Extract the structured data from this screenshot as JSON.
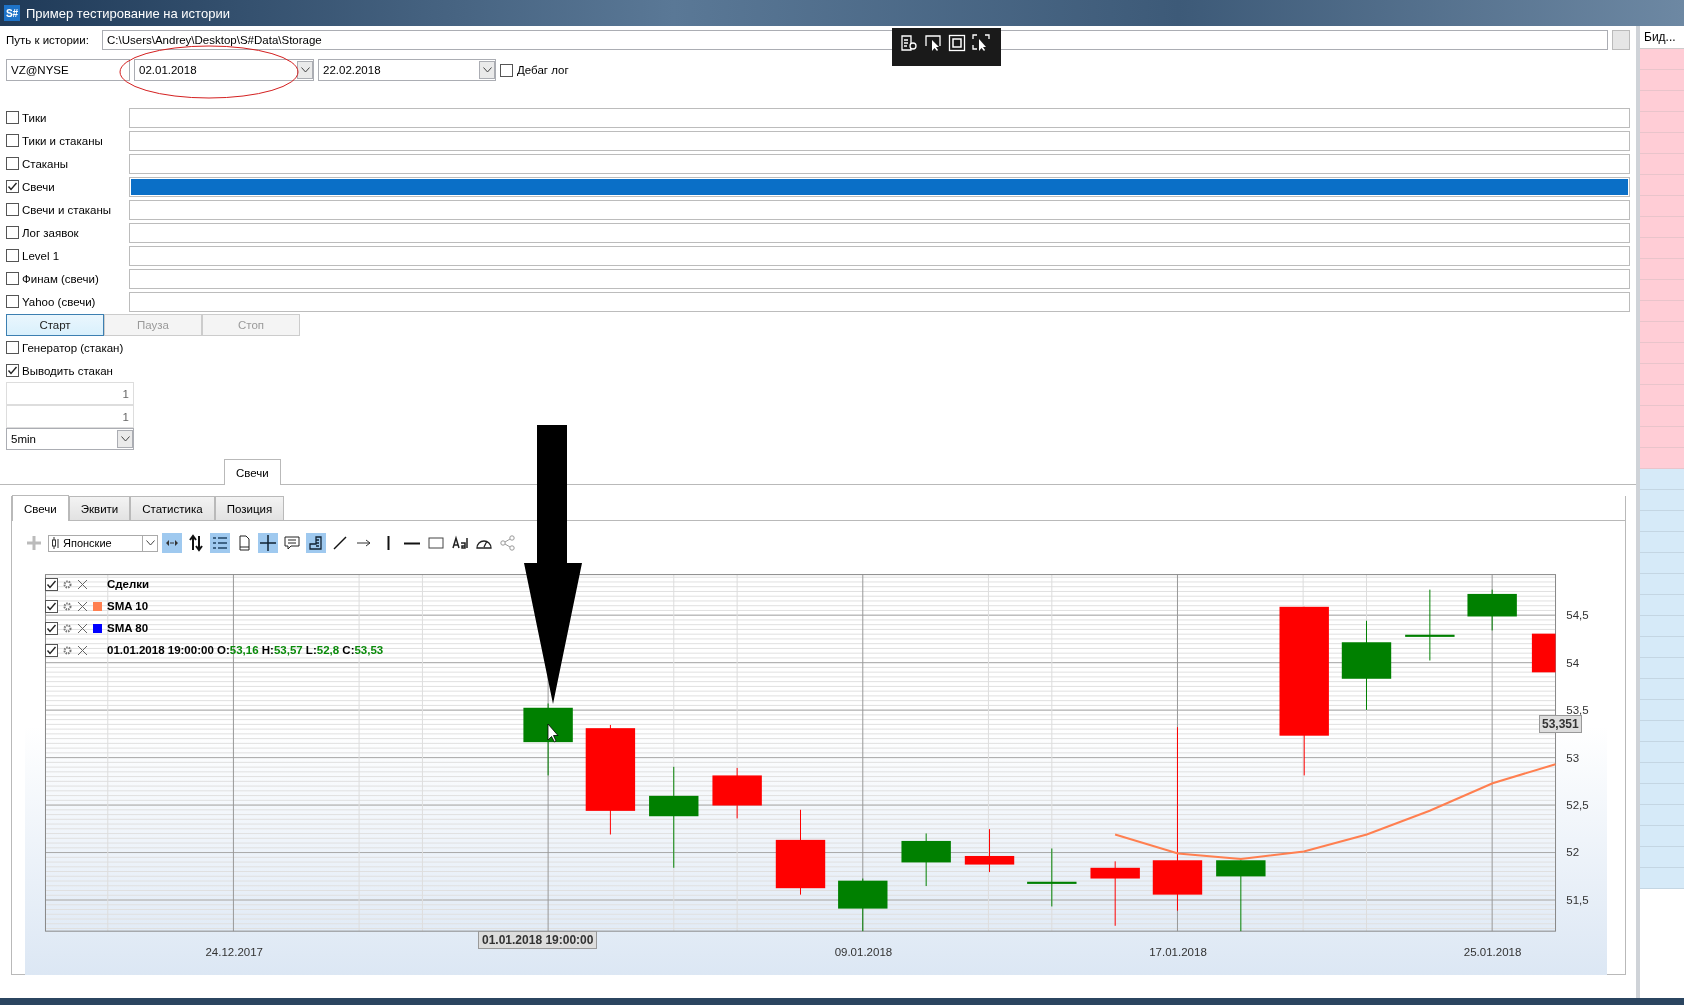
{
  "window": {
    "title": "Пример тестирование на истории",
    "icon_text": "S#"
  },
  "history_path": {
    "label": "Путь к истории:",
    "value": "C:\\Users\\Andrey\\Desktop\\S#Data\\Storage"
  },
  "security": {
    "value": "VZ@NYSE"
  },
  "date_from": {
    "value": "02.01.2018"
  },
  "date_to": {
    "value": "22.02.2018"
  },
  "debug_log": {
    "label": "Дебаг лог",
    "checked": false
  },
  "sources": [
    {
      "label": "Тики",
      "checked": false,
      "selected": false
    },
    {
      "label": "Тики и стаканы",
      "checked": false,
      "selected": false
    },
    {
      "label": "Стаканы",
      "checked": false,
      "selected": false
    },
    {
      "label": "Свечи",
      "checked": true,
      "selected": true
    },
    {
      "label": "Свечи и стаканы",
      "checked": false,
      "selected": false
    },
    {
      "label": "Лог заявок",
      "checked": false,
      "selected": false
    },
    {
      "label": "Level 1",
      "checked": false,
      "selected": false
    },
    {
      "label": "Финам (свечи)",
      "checked": false,
      "selected": false
    },
    {
      "label": "Yahoo (свечи)",
      "checked": false,
      "selected": false
    }
  ],
  "buttons": [
    {
      "label": "Старт",
      "disabled": false,
      "selected": true
    },
    {
      "label": "Пауза",
      "disabled": true,
      "selected": false
    },
    {
      "label": "Стоп",
      "disabled": true,
      "selected": false
    }
  ],
  "options": [
    {
      "label": "Генератор (стакан)",
      "checked": false
    },
    {
      "label": "Выводить стакан",
      "checked": true
    }
  ],
  "numeric_fields": [
    {
      "value": "1"
    },
    {
      "value": "1"
    }
  ],
  "timeframe": {
    "value": "5min"
  },
  "outer_tabs": [
    {
      "label": "Свечи",
      "selected": true
    }
  ],
  "inner_tabs": [
    {
      "label": "Свечи",
      "selected": true
    },
    {
      "label": "Эквити",
      "selected": false
    },
    {
      "label": "Статистика",
      "selected": false
    },
    {
      "label": "Позиция",
      "selected": false
    }
  ],
  "chart_toolbar": {
    "chart_style": "Японские",
    "tools": [
      {
        "kind": "autoscroll",
        "pressed": true
      },
      {
        "kind": "updown",
        "pressed": false
      },
      {
        "kind": "legend",
        "pressed": true
      },
      {
        "kind": "page",
        "pressed": false
      },
      {
        "kind": "crosshair",
        "pressed": true
      },
      {
        "kind": "comment",
        "pressed": false
      },
      {
        "kind": "ruler",
        "pressed": true
      },
      {
        "kind": "line",
        "pressed": false
      },
      {
        "kind": "arrow",
        "pressed": false
      },
      {
        "kind": "vline",
        "pressed": false
      },
      {
        "kind": "hline",
        "pressed": false
      },
      {
        "kind": "rect",
        "pressed": false
      },
      {
        "kind": "text",
        "pressed": false
      },
      {
        "kind": "gauge",
        "pressed": false
      },
      {
        "kind": "share",
        "pressed": false
      }
    ]
  },
  "legend": [
    {
      "label": "Сделки",
      "checked": true
    },
    {
      "kind": "series",
      "checked": true,
      "color": "#ff7f50"
    },
    {
      "label": "SMA 80",
      "checked": true,
      "color": "#0000ff"
    },
    {
      "checked": true,
      "parts": [
        {
          "text": "01.01.2018 19:00:00 O:",
          "kind": "name"
        },
        {
          "text": "53,16",
          "kind": "value"
        },
        {
          "text": " H:",
          "kind": "name"
        },
        {
          "text": "53,57",
          "kind": "value"
        },
        {
          "text": " L:",
          "kind": "name"
        },
        {
          "text": "52,8",
          "kind": "value"
        },
        {
          "text": " C:",
          "kind": "name"
        },
        {
          "text": "53,53",
          "kind": "value"
        }
      ]
    }
  ],
  "chart": {
    "chart_data": {
      "type": "line",
      "grid": true,
      "categories": [
        null,
        null,
        null,
        "24.12.2017",
        null,
        null,
        null,
        null,
        null,
        null,
        null,
        null,
        null,
        "09.01.2018",
        null,
        null,
        null,
        null,
        "17.01.2018",
        null,
        null,
        null,
        null,
        "25.01.2018",
        null
      ],
      "series": [
        {
          "name": "SMA 10",
          "color": "#ff7f50",
          "values": [
            null,
            null,
            null,
            null,
            null,
            null,
            null,
            null,
            null,
            null,
            null,
            null,
            null,
            null,
            null,
            null,
            null,
            52.19,
            51.99,
            51.93,
            52.01,
            52.19,
            52.44,
            52.73,
            52.93
          ]
        }
      ],
      "ylim": [
        51.17,
        54.93
      ],
      "yticks": [
        {
          "value": 54.5,
          "label": "54,5"
        },
        {
          "value": 54,
          "label": "54"
        },
        {
          "value": 53.5,
          "label": "53,5"
        },
        {
          "value": 53,
          "label": "53"
        },
        {
          "value": 52.5,
          "label": "52,5"
        },
        {
          "value": 52,
          "label": "52"
        },
        {
          "value": 51.5,
          "label": "51,5"
        }
      ]
    }
  },
  "cursor_time": "01.01.2018 19:00:00",
  "cursor_price": "53,351",
  "side_panel": {
    "header": "Бид..."
  }
}
